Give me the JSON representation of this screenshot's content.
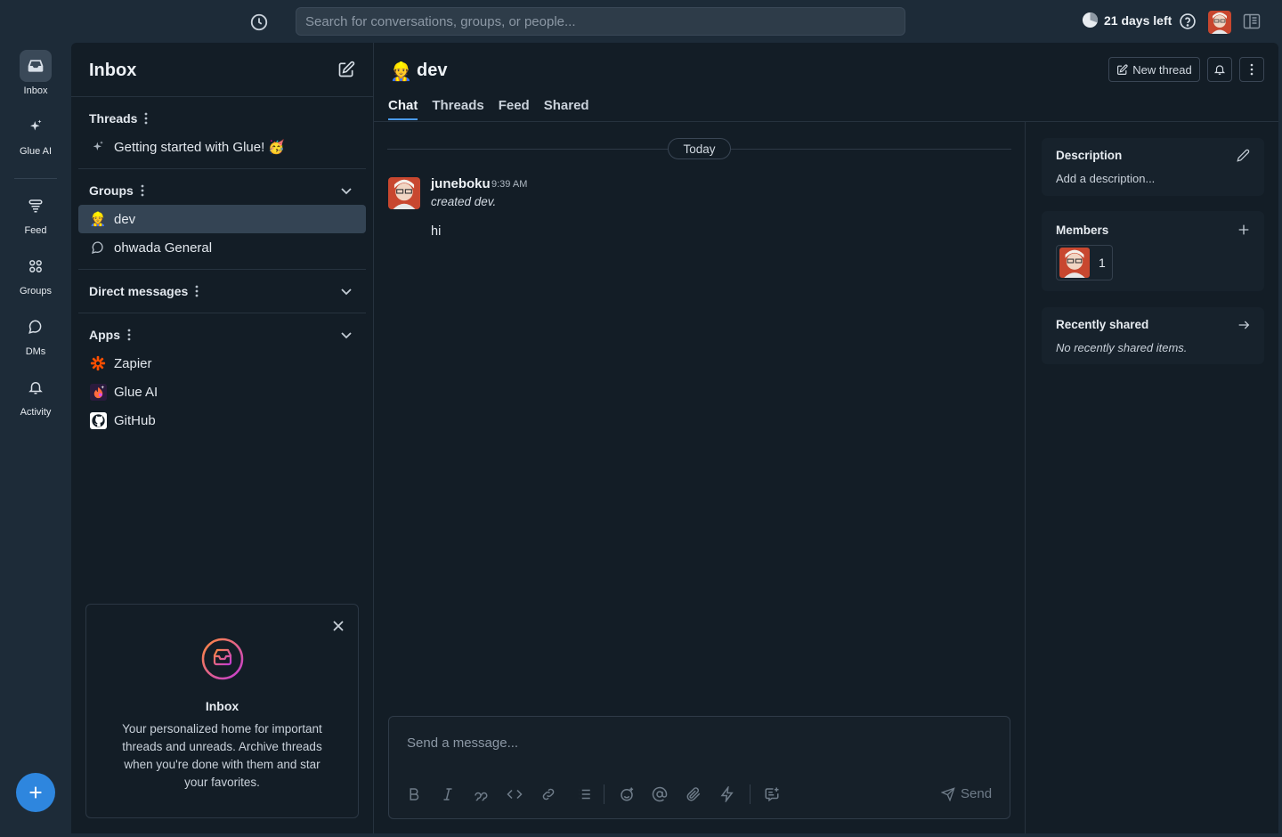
{
  "topbar": {
    "search_placeholder": "Search for conversations, groups, or people...",
    "trial_text": "21 days left"
  },
  "rail": {
    "items": [
      {
        "label": "Inbox",
        "icon": "inbox-icon"
      },
      {
        "label": "Glue AI",
        "icon": "sparkle-icon"
      },
      {
        "label": "Feed",
        "icon": "feed-icon"
      },
      {
        "label": "Groups",
        "icon": "groups-icon"
      },
      {
        "label": "DMs",
        "icon": "chat-bubble-icon"
      },
      {
        "label": "Activity",
        "icon": "bell-icon"
      }
    ]
  },
  "inbox": {
    "title": "Inbox",
    "threads_label": "Threads",
    "thread_items": [
      {
        "label": "Getting started with Glue! 🥳"
      }
    ],
    "groups_label": "Groups",
    "groups": [
      {
        "label": "dev",
        "emoji": "👷"
      },
      {
        "label": "ohwada General"
      }
    ],
    "dms_label": "Direct messages",
    "apps_label": "Apps",
    "apps": [
      {
        "label": "Zapier"
      },
      {
        "label": "Glue AI"
      },
      {
        "label": "GitHub"
      }
    ],
    "promo": {
      "title": "Inbox",
      "text": "Your personalized home for important threads and unreads. Archive threads when you're done with them and star your favorites."
    }
  },
  "chat": {
    "channel_emoji": "👷",
    "channel_name": "dev",
    "new_thread_label": "New thread",
    "tabs": [
      "Chat",
      "Threads",
      "Feed",
      "Shared"
    ],
    "date_divider": "Today",
    "message": {
      "author": "juneboku",
      "time": "9:39 AM",
      "system_text": "created dev.",
      "text": "hi"
    },
    "composer_placeholder": "Send a message...",
    "send_label": "Send"
  },
  "details": {
    "description_title": "Description",
    "description_placeholder": "Add a description...",
    "members_title": "Members",
    "member_count": "1",
    "recent_title": "Recently shared",
    "recent_empty": "No recently shared items."
  },
  "colors": {
    "accent": "#2e86de",
    "active_tab_underline": "#4a9bec",
    "app_bg": "#1d2b38",
    "panel_bg": "#131d26",
    "zapier": "#ff4f00"
  }
}
